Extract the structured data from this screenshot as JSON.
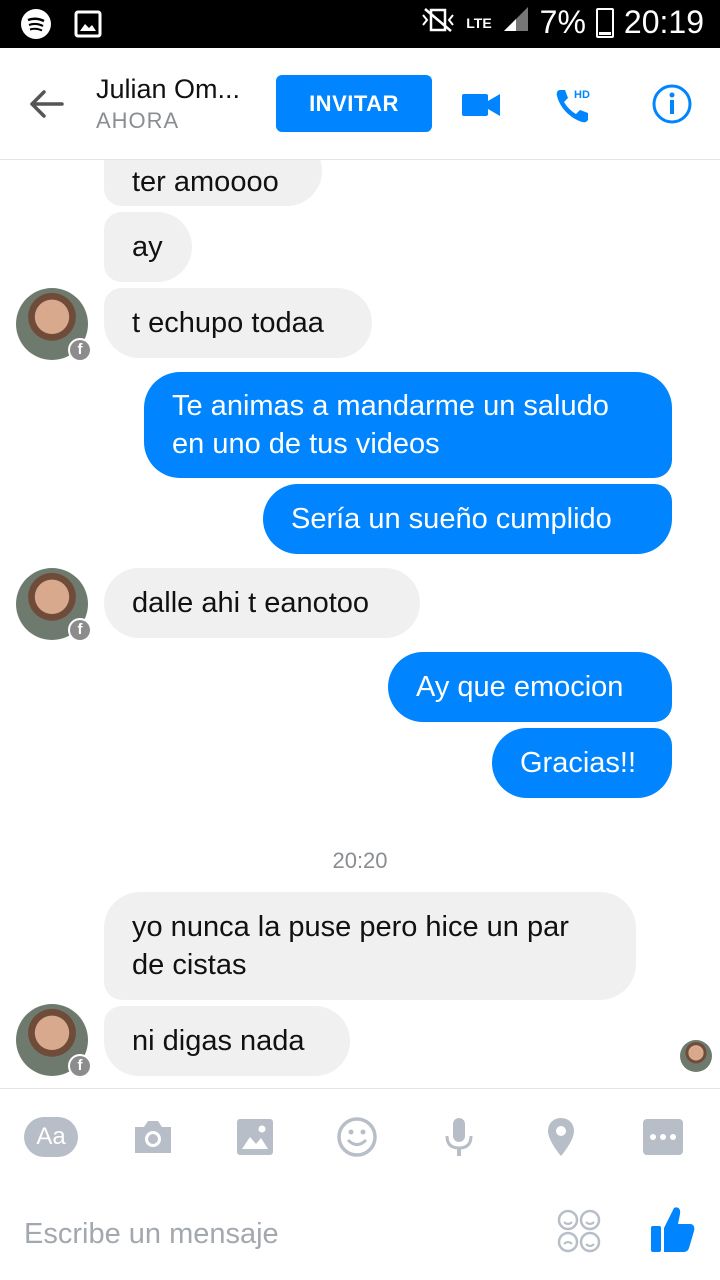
{
  "status_bar": {
    "network": "LTE",
    "battery": "7%",
    "time": "20:19"
  },
  "header": {
    "contact_name": "Julian Om...",
    "contact_status": "AHORA",
    "invite_label": "INVITAR",
    "hd_label": "HD"
  },
  "messages": [
    {
      "from": "them",
      "text": "ter amoooo"
    },
    {
      "from": "them",
      "text": "ay"
    },
    {
      "from": "them",
      "text": "t echupo todaa"
    },
    {
      "from": "me",
      "text": "Te animas a mandarme un saludo en uno de tus videos"
    },
    {
      "from": "me",
      "text": "Sería un sueño cumplido"
    },
    {
      "from": "them",
      "text": "dalle ahi t eanotoo"
    },
    {
      "from": "me",
      "text": "Ay que emocion"
    },
    {
      "from": "me",
      "text": "Gracias!!"
    },
    {
      "from": "them",
      "text": "yo nunca la puse pero hice un par de cistas"
    },
    {
      "from": "them",
      "text": "ni digas nada"
    }
  ],
  "timestamp": "20:20",
  "toolbar": {
    "aa_label": "Aa"
  },
  "composer": {
    "placeholder": "Escribe un mensaje"
  },
  "colors": {
    "accent": "#0084ff",
    "incoming_bubble": "#f1f0f0",
    "icon_gray": "#b8bec7"
  }
}
